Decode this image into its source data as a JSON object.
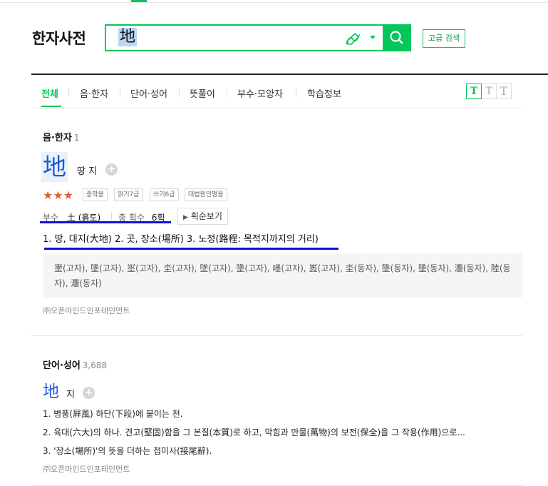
{
  "app": {
    "title": "한자사전",
    "search_value": "地",
    "advanced_search_label": "고급 검색"
  },
  "tabs": [
    {
      "label": "전체",
      "active": true
    },
    {
      "label": "음·한자"
    },
    {
      "label": "단어·성어"
    },
    {
      "label": "뜻풀이"
    },
    {
      "label": "부수·모양자"
    },
    {
      "label": "학습정보"
    }
  ],
  "font_size_buttons": [
    "T",
    "T",
    "T"
  ],
  "eum_hanja": {
    "section_title": "음·한자",
    "count": "1",
    "hanja": "地",
    "reading": "땅 지",
    "rating_stars": "★★★",
    "badges": [
      "중학용",
      "읽기7급",
      "쓰기6급",
      "대법원인명용"
    ],
    "radical_label": "부수",
    "radical_value": "土 (흙토)",
    "stroke_label": "총 획수",
    "stroke_value": "6획",
    "stroke_order_button": "획순보기",
    "meanings": "1. 땅, 대지(大地)  2. 곳, 장소(場所)  3. 노정(路程: 목적지까지의 거리)",
    "related": "壍(고자), 墬(고자), 埊(고자), 坔(고자), 墜(고자), 墬(고자), 嚜(고자), 嶳(고자), 坔(동자), 墬(동자), 墬(동자), 灋(동자), 陸(동자), 灋(동자)",
    "source": "㈜오픈마인드인포테인먼트"
  },
  "words": {
    "section_title": "단어·성어",
    "count": "3,688",
    "hanja": "地",
    "reading": "지",
    "lines": [
      "1. 병풍(屛風) 하단(下段)에 붙이는 천.",
      "2. 육대(六大)의 하나. 견고(堅固)함을 그 본질(本質)로 하고, 막힘과 만물(萬物)의 보전(保全)을 그 작용(作用)으로...",
      "3. '장소(場所)'의 뜻을 더하는 접미사(接尾辭)."
    ],
    "source": "㈜오픈마인드인포테인먼트"
  }
}
